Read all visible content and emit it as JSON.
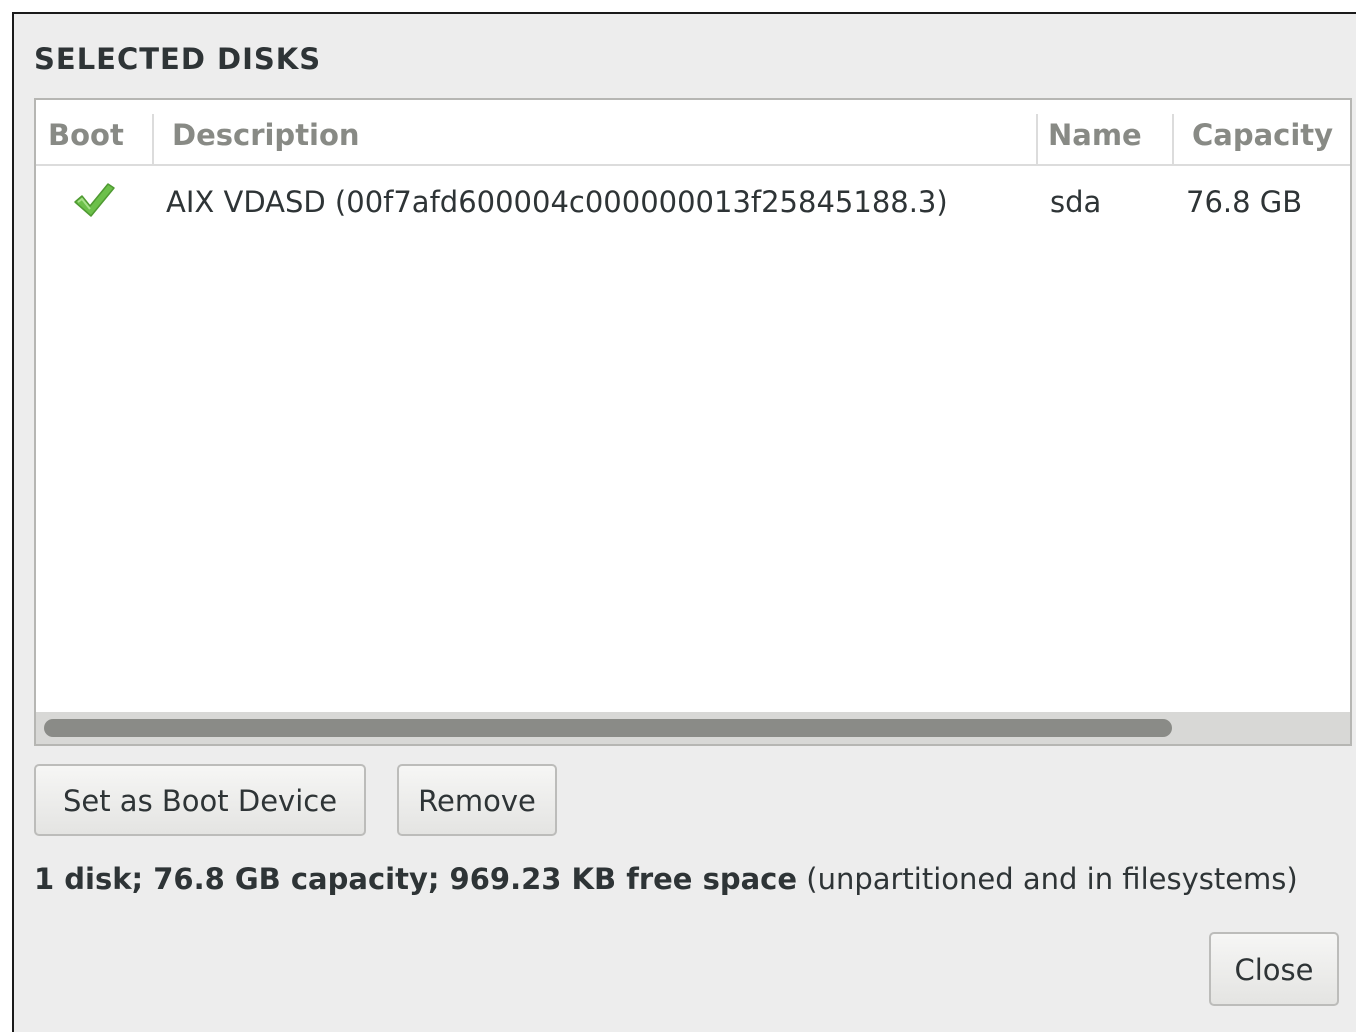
{
  "dialog": {
    "title": "SELECTED DISKS"
  },
  "table": {
    "columns": {
      "boot": "Boot",
      "description": "Description",
      "name": "Name",
      "capacity": "Capacity"
    },
    "rows": [
      {
        "boot": true,
        "description": "AIX VDASD (00f7afd600004c000000013f25845188.3)",
        "name": "sda",
        "capacity": "76.8 GB"
      }
    ]
  },
  "buttons": {
    "set_boot": "Set as Boot Device",
    "remove": "Remove",
    "close": "Close"
  },
  "summary": {
    "bold_part": "1 disk; 76.8 GB capacity; 969.23 KB free space",
    "normal_part": " (unpartitioned and in filesystems)"
  },
  "icons": {
    "boot_check": "checkmark-icon"
  },
  "colors": {
    "check_green": "#6cc04a",
    "dialog_bg": "#ededed"
  }
}
